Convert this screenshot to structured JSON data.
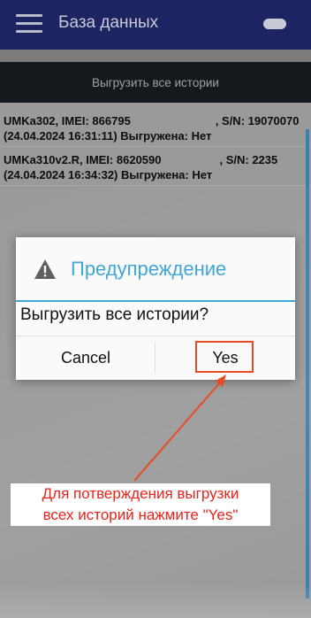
{
  "appbar": {
    "title": "База данных",
    "menu_icon": "hamburger-menu-icon",
    "toggle_icon": "toggle-switch-icon"
  },
  "upload_all_label": "Выгрузить все истории",
  "records": [
    {
      "line1_left": "UMKa302, IMEI: 866795",
      "line1_right": ", S/N: 19070070",
      "line2": "(24.04.2024 16:31:11) Выгружена: Нет"
    },
    {
      "line1_left": "UMKa310v2.R, IMEI: 8620590",
      "line1_right": ", S/N: 2235",
      "line2": "(24.04.2024 16:34:32) Выгружена: Нет"
    }
  ],
  "dialog": {
    "title": "Предупреждение",
    "icon": "warning-icon",
    "message": "Выгрузить все истории?",
    "cancel_label": "Cancel",
    "yes_label": "Yes"
  },
  "annotation": {
    "line1": "Для потверждения выгрузки",
    "line2": "всех историй нажмите \"Yes\""
  },
  "colors": {
    "appbar": "#1e2461",
    "accent": "#3fa7d6",
    "annotation": "#e8231c",
    "highlight": "#e84a24"
  }
}
